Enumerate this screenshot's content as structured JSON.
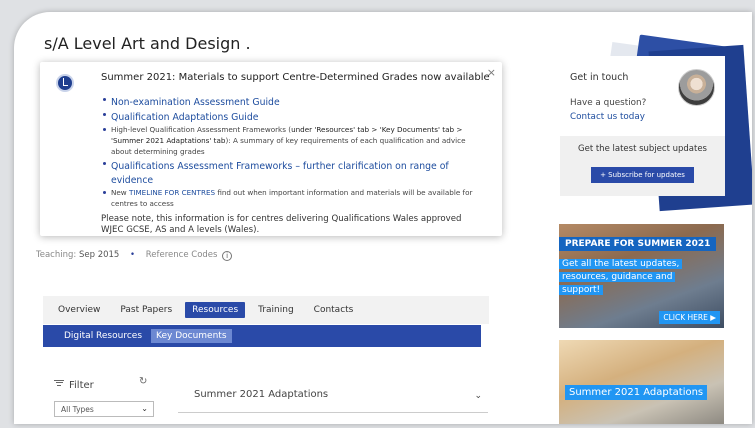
{
  "page_title": "s/A Level Art and Design .",
  "notice": {
    "title": "Summer 2021: Materials to support Centre-Determined Grades now available",
    "close": "×",
    "items": [
      {
        "text": "Non-examination Assessment Guide"
      },
      {
        "text": "Qualification Adaptations Guide"
      },
      {
        "pre": "High-level Qualification Assessment Frameworks (",
        "highlight": "under 'Resources' tab > 'Key Documents' tab > 'Summer 2021 Adaptations' tab",
        "post": "): A summary of key requirements of each qualification and advice about determining grades"
      },
      {
        "text": "Qualifications Assessment Frameworks – further clarification on range of evidence"
      },
      {
        "pre": "New ",
        "link": "TIMELINE FOR CENTRES",
        "post": " find out when important information and materials will be available for centres to access"
      }
    ],
    "note": "Please note, this information is for centres delivering Qualifications Wales approved WJEC GCSE, AS and A levels (Wales)."
  },
  "meta": {
    "teaching_label": "Teaching:",
    "teaching_value": "Sep 2015",
    "reference_codes": "Reference Codes",
    "info_glyph": "i"
  },
  "tabs": [
    "Overview",
    "Past Papers",
    "Resources",
    "Training",
    "Contacts"
  ],
  "active_tab": "Resources",
  "subtabs": [
    "Digital Resources",
    "Key Documents"
  ],
  "active_subtab": "Key Documents",
  "filter": {
    "label": "Filter",
    "refresh_glyph": "↻",
    "select_value": "All Types",
    "chevron": "⌄"
  },
  "accordion": {
    "label": "Summer 2021 Adaptations",
    "chevron": "⌄"
  },
  "get_in_touch": {
    "title": "Get in touch",
    "question": "Have a question?",
    "link": "Contact us today"
  },
  "updates": {
    "text": "Get the latest subject updates",
    "button": "+ Subscribe for updates"
  },
  "promo1": {
    "title": "PREPARE FOR SUMMER 2021",
    "body": "Get all the latest updates, resources, guidance and support!",
    "cta": "CLICK HERE ▶"
  },
  "promo2": {
    "title": "Summer 2021 Adaptations"
  },
  "colors": {
    "primary_blue": "#2a4aa8",
    "link_blue": "#1d4c9e",
    "promo_blue": "#2196f3"
  }
}
